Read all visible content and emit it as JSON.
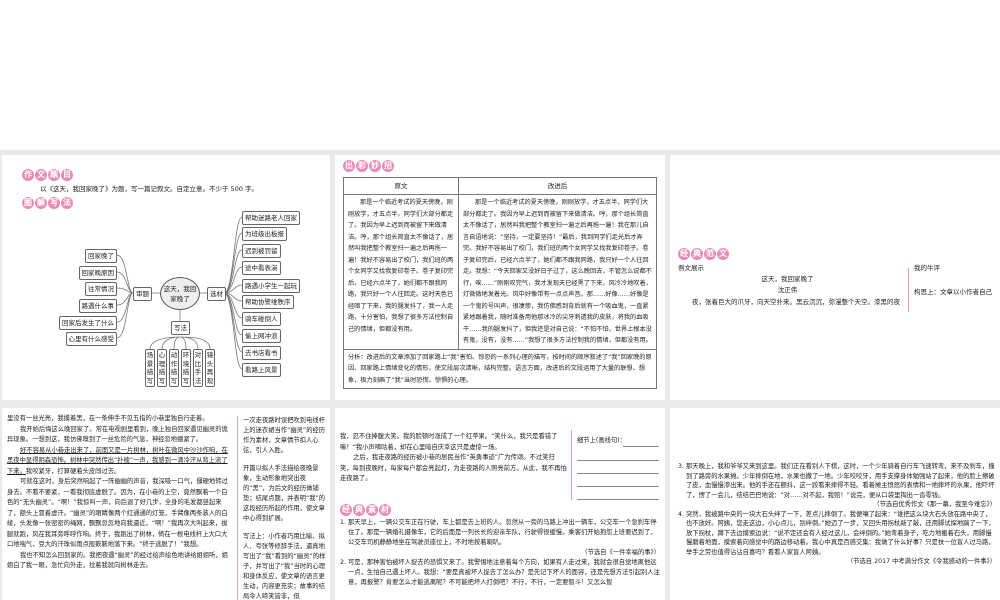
{
  "p1": {
    "heading1": [
      "作",
      "文",
      "题",
      "目"
    ],
    "prompt": "以《这天，我回家晚了》为题，写一篇记叙文。自定立意。不少于 500 字。",
    "heading2": [
      "图",
      "解",
      "写",
      "法"
    ],
    "center": "这天，我回家晚了",
    "shenti": "审题",
    "xuancai": "选材",
    "xiefa": "写法",
    "left_items": [
      "回家晚了",
      "回家晚原因",
      "往常情况",
      "路遇什么事",
      "回家后发生了什么",
      "心里有什么感受"
    ],
    "right_items": [
      "帮助迷路老人回家",
      "为班级出板报",
      "迟到被罚留",
      "途中看表演",
      "路遇小学生一起玩",
      "帮助协警维秩序",
      "骑车碰倒人",
      "偷上网冲浪",
      "去书店看书",
      "看路上风景"
    ],
    "bottom_items": [
      "场景描写",
      "心理描写",
      "动作描写",
      "环境描写",
      "对比手法",
      "镜头再现"
    ]
  },
  "p2": {
    "heading": [
      "出",
      "彩",
      "妙",
      "招"
    ],
    "col1": "原文",
    "col2": "改进后",
    "original": "那是一个临近考试的夏天傍晚，刚刚放学，才五点半，同学们大部分都走了。我因为早上迟到而被留下来做清洁。哼，那个组长简直太不像话了，居然叫我把整个教室扫一遍之后再拖一遍！我好不容易出了校门，我们班的两个女同学又找我复印卷子。卷子复印完后，已经六点半了，她们都不跟我同路，我只好一个人往回走。这时天色已经暗了下来，我的腿发抖了，我一人走路，十分害怕，我想了很多方法控制自己的情绪，但都没有用。",
    "improved": "那是一个临近考试的夏天傍晚，刚刚放学，才五点半，同学们大部分都走了。我因为早上迟到而被留下来做清洁。哼，那个组长简直太不像话了，居然叫我把整个教室扫一遍之后再拖一遍！我在那儿自言自语地说：“坚持，一定要坚持！”最后，我到同学们走光后才弄完。我好不容易出了校门，我们班的两个女同学又找我复印卷子。卷子复印完后，已经六点半了，她们都不跟我同路，我只好一个人往回走。我想：“今天回家又没好日子过了，这么晚回去，不管怎么说都不行，唉……”刚刚叹完气，我才发现天已经黑了下来，风冷冷地吹着，灯微微地发着光。风中好像带有一点点声音。那……好像……好像是一个鬼的号叫声，很凄惨，我仿佛感到背后就有一个吸血鬼，一直紧紧地跟着我，随时准备用他那冰冷的尖牙刺透我的皮肤，将我的血吸干……我的腿发抖了，但我还是对自己说：“不怕不怕，世界上根本没有鬼，没有，没有……”我想了很多方法控制我的情绪，但都没有用。",
    "analysis": "分析：改进后的文章添加了回家路上“我”害怕、惊恐的一系列心理的描写，按时间的顺序叙述了“我”回家晚的原因、回家路上情绪变化的情形，使文段层次清晰，结构完整。语言方面，改进后的文段运用了大量的联想、想象，极力刻画了“我”当时恐慌、惊惧的心理。"
  },
  "p3": {
    "heading": [
      "经",
      "典",
      "范",
      "文"
    ],
    "label": "例文展示",
    "title": "这天，我回家晚了",
    "author": "沈正伟",
    "first_line": "夜，张着巨大的爪牙，向天空扑来。黑云沉沉，弥漫整个天空。漆黑的夜",
    "side_title": "我的牛评",
    "side_text": "构思上：文章以小作者自己"
  },
  "p4": {
    "para1": "里没有一丝光亮，我摸着黑，在一条伸手不见五指的小巷里独自行走着。",
    "para2": "我开始后悔这么晚回家了。常在电视剧里看到，晚上独自回家遇见幽灵的诡异现象。一想到这，我仿佛嗅到了一丝危险的气息，神经忽地绷紧了。",
    "para3_ul": "好不容易从小巷走出来了，前面又是一片树林，树叶在微风中沙沙作响，在黑夜中显得阴森恐怖。树林中突然传出“扑棱”一声，我感到一滴冷汗从背上流了下来。",
    "para3_rest": "我咬紧牙，打算硬着头皮闯过去。",
    "para4": "可就在这时，身后突然响起了一阵幽幽的声音，我深吸一口气，僵硬地转过身去。不看不要紧，一看我彻底虚脱了。因为，在小巷的上空，竟然飘着一个白色的“无头幽灵”。“啊！”我惊叫一声，向后退了好几步，全身的毛发都竖起来了，额头上冒着虚汗。“幽灵”的眼睛像两个红通通的灯笼，手臂像两条骇人的白绫，头发像一张密密的绳网，飘飘忽忽地向我逼近。“啊！”我再次大叫起来，拔腿就跑，风在我耳旁呼呼作响。终于，我跑出了树林，倚在一根电线杆上大口大口地喘气，豆大的汗珠似雨点般簌簌地落下来。“终于逃脱了！”我想。",
    "para5": "我也不知怎么回到家的。我把夜遇“幽灵”的经过绘声绘色地讲给姐姐听，姐姐白了我一眼，急忙向外走，拉着我就向树林走去。",
    "side1": "一次走夜路时误把吹到电线杆上的迷衣裙当作“幽灵”的经历作为素材，文章情节扣人心弦，引人入胜。",
    "side2": "开篇以拟人手法描绘夜晚景象，生动形象地突出夜的“黑”，为后文的经历做铺垫；结尾点题，并表明“我”的这段经历所起的作用，使文章中心得到扩展。",
    "side3": "写法上：小作者巧用比喻、拟人、夸张等修辞手法，逼真地写出了“我”看到的“幽灵”的样子，并写出了“我”当时的心理和身体反应，使文章的语言更生动，内容更充实；故事的结局令人啼笑皆非，但"
  },
  "p5": {
    "para1": "我，忍不住捧腹大笑。我的脸顿时涨成了一个红苹果。“笑什么，我只是看错了嘛！”我小声嘀咕着，却在心里暗自庆幸这只是虚惊一场。",
    "para2": "之后，我走夜路的经历被小巷的居民当作“英勇事迹”广为传颂。不过笑归笑，每到夜晚时，每家每户都会亮起灯，为走夜路的人照亮前方。从此，我不再怕走夜路了。",
    "side_label": "细节上(画线句)：",
    "heading": [
      "经",
      "典",
      "素",
      "材"
    ],
    "item1": "1. 那天早上，一辆公交车正在行驶，车上都是去上班的人。忽然从一旁的马路上冲出一辆车，公交车一个急刹车停住了。那是一辆婚礼摄像车，它的后面是一列长长的迎亲车队，行驶得很缓慢。乘客们开始抱怨上班要迟到了，公交车司机静静地坐在驾驶员座位上，不时地按着喇叭。",
    "source1": "（节选自《一件幸福的事》）",
    "item2": "2. 可是，那种害怕被坏人捉去的恐惧又来了。我警惕地注意着每个方向，如果有人走过来，我就会很自觉地离他远一点，生怕自己遇上坏人。我想：“要是真被坏人捉去了怎么办？是先记下坏人的面容，还是先想方法引起别人注意，再报警？肯要怎么才能逃离呢？不可能把坏人打倒吧？不行，不行，一定要智斗！又怎么智"
  },
  "p6": {
    "item3": "3. 那天晚上，我和爷爷又来到这里。我们正在看别人下棋，这时，一个少年骑着自行车飞速转弯，来不及刹车，撞到了路旁的水果摊。少年摔倒在地，水果也撒了一地。少年咬咬牙，用手支撑身体勉强站了起来，他的脸上擦破了皮，血慢慢渗出来。他的手还在颤抖，这一跤看来摔得不轻。看着摊主愤怒的表情和一地摔坏的水果，他吓坏了，愣了一会儿，结结巴巴地说：“对……对不起，我赔！”说完，便从口袋里掏出一沓零钱。",
    "source3": "（节选自优秀作文《那一幕，我至今难忘》）",
    "item4": "4. 突然，我被路中央的一块大石头绊了一下，差点儿摔倒了。我便嚷了起来：“谁把这么块大石头放在路中央了，也不放好。阿姨，您走这边，小心点儿，别绊倒。”她迈了一步，又回头用拐杖敲了敲，还用脚试探地踹了一下，放下拐杖，蹲下去边摸索边说：“说不定还会有人经过这儿，会绊倒的。”她弯着身子，吃力地搬着石头，用脚慢慢磨着地面，摸索着向感觉中的路边移动着。我心中真是百感交集：我做了什么好事？只是扶一位盲人过马路，举手之劳也值得沾沾自喜吗？看看人家盲人阿姨。",
    "source4": "（节选自 2017 中考满分作文《令我感动的一件事》）"
  }
}
